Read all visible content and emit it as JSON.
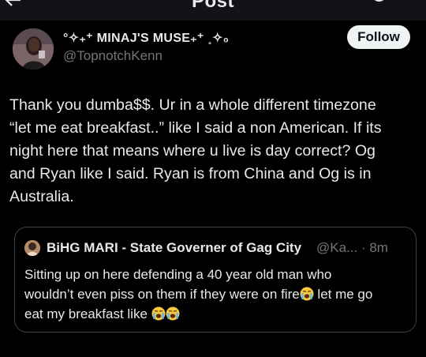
{
  "header": {
    "title": "Post"
  },
  "author": {
    "display_name": "°✧₊⁺ MINAJ'S MUSE₊⁺ ˳✧₀",
    "username": "@TopnotchKenn",
    "avatar_icon": "user-avatar"
  },
  "follow_button": {
    "label": "Follow"
  },
  "post": {
    "lines": [
      "Thank you dumba$$. Ur in a whole different timezone",
      "“let me eat breakfast..” like I said a non American.  If its",
      "night here that means where u live is day correct? Og",
      "and Ryan like I said. Ryan is from China and Og is in",
      "Australia."
    ]
  },
  "quoted_post": {
    "author_name": "BiHG MARI - State Governer of Gag City",
    "handle_and_time": "@Ka... · 8m",
    "line1": "Sitting up on here defending a 40 year old man who",
    "line2_before": "wouldn’t even piss on them if they were on fire",
    "line2_after": " let me go",
    "line3": "eat my breakfast like",
    "emoji_icon": "loudly-crying-face-icon"
  },
  "colors": {
    "background": "#000000",
    "text_primary": "#e7e9ea",
    "text_secondary": "#71767b",
    "follow_bg": "#eff3f4",
    "card_border": "#3d4146"
  }
}
